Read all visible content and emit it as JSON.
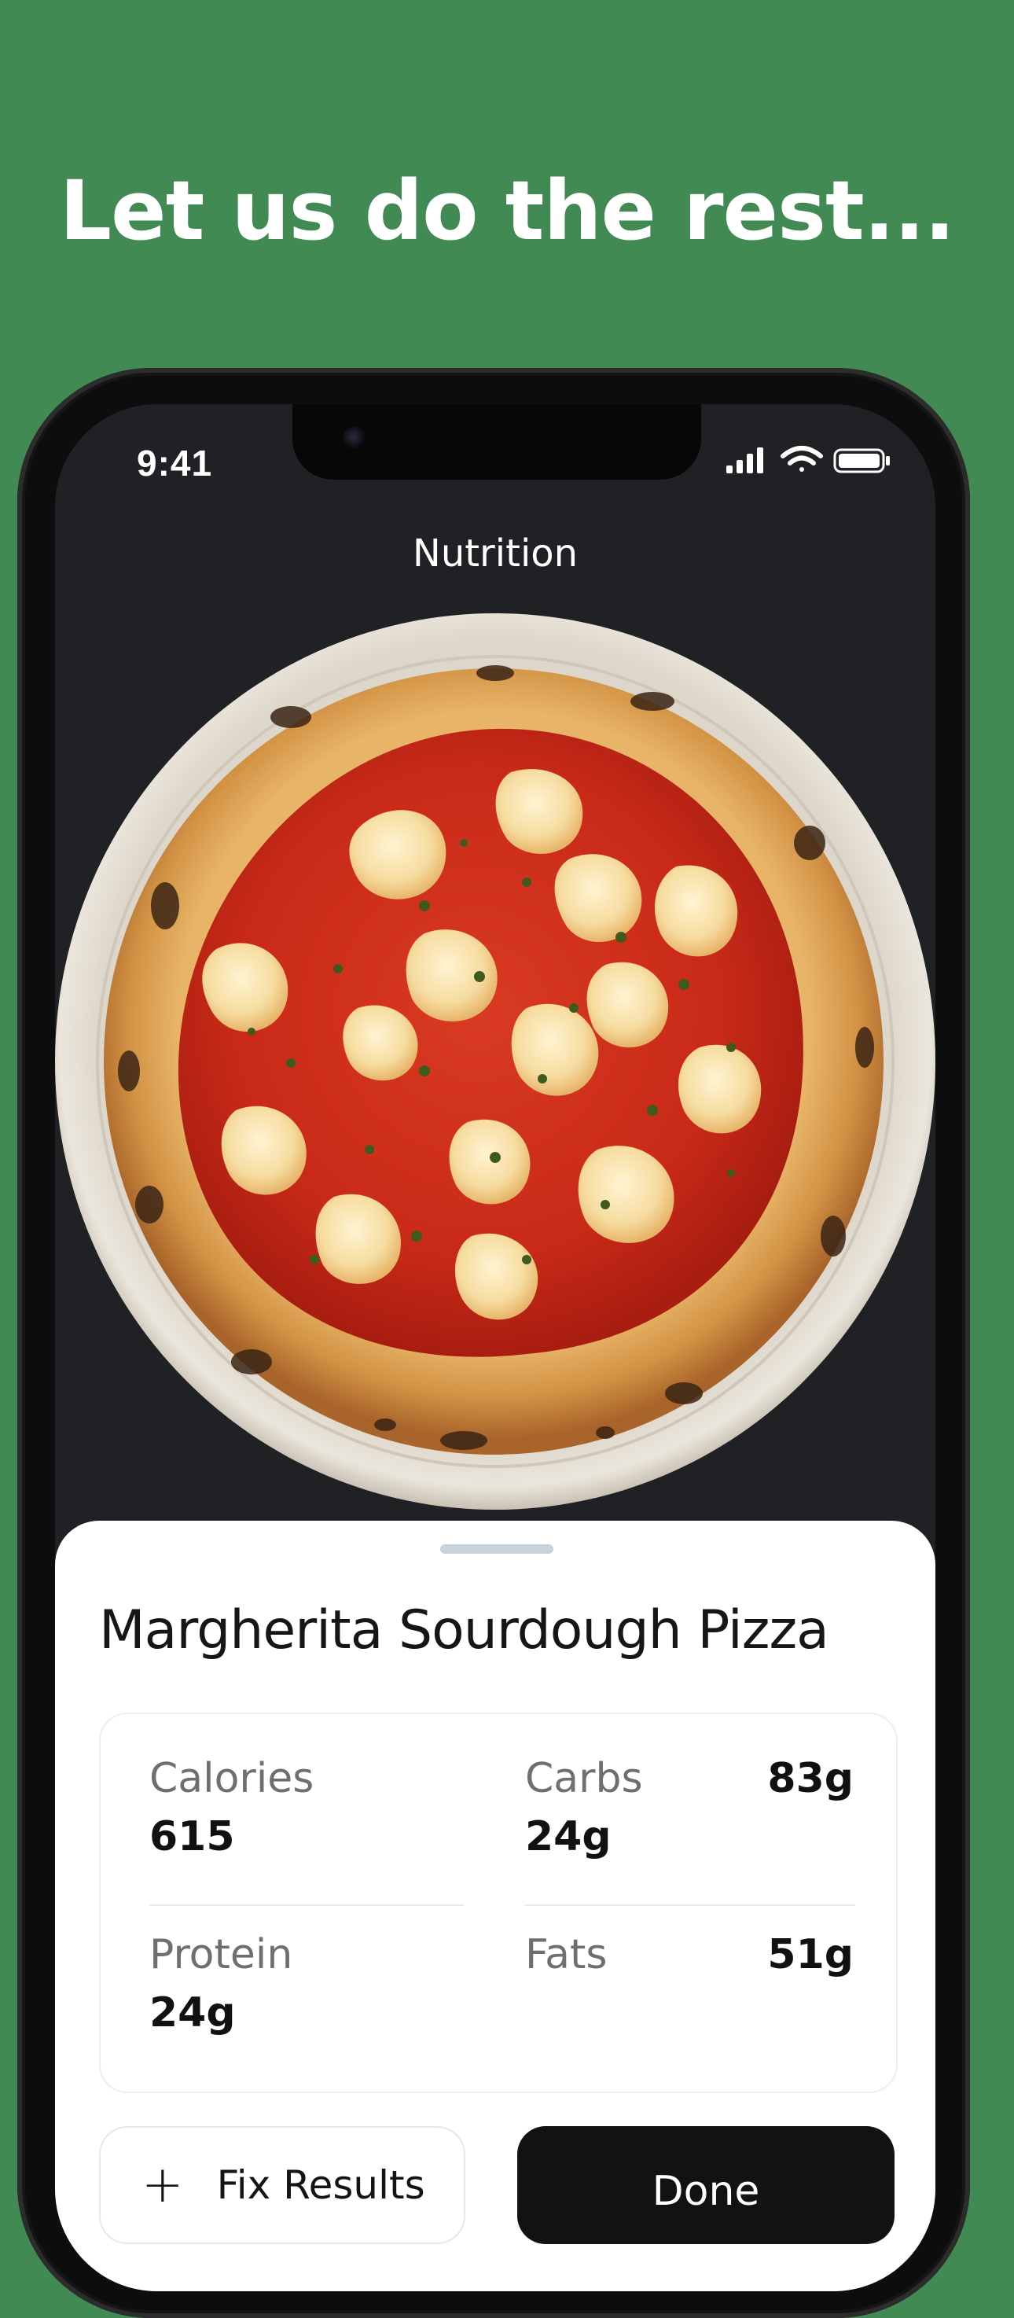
{
  "promo": {
    "headline": "Let us do the rest..."
  },
  "status_bar": {
    "time": "9:41",
    "icons": [
      "signal-icon",
      "wifi-icon",
      "battery-icon"
    ]
  },
  "screen": {
    "title": "Nutrition"
  },
  "food": {
    "name": "Margherita Sourdough Pizza",
    "image": "margherita-pizza-photo"
  },
  "nutrition": {
    "calories": {
      "label": "Calories",
      "value": "615"
    },
    "carbs": {
      "label": "Carbs",
      "value": "24g",
      "side_value": "83g"
    },
    "protein": {
      "label": "Protein",
      "value": "24g"
    },
    "fats": {
      "label": "Fats",
      "side_value": "51g"
    }
  },
  "actions": {
    "fix_results": {
      "icon": "plus-icon",
      "label": "Fix Results"
    },
    "done": {
      "label": "Done"
    }
  },
  "colors": {
    "background": "#418a54",
    "screen": "#202124",
    "sheet": "#ffffff",
    "primary_button": "#121212"
  }
}
